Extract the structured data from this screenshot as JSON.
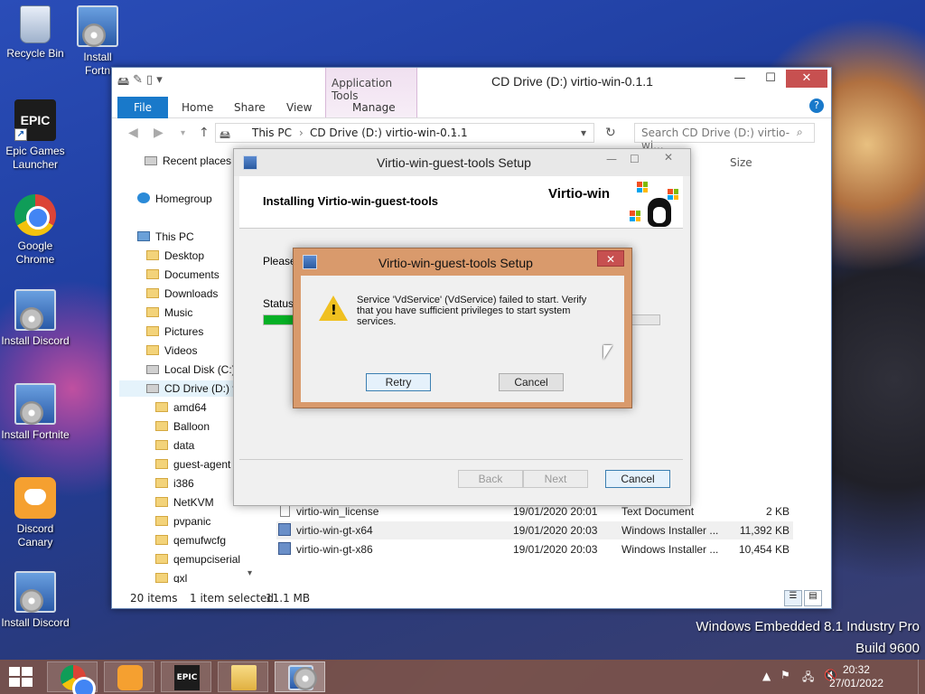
{
  "desktop": {
    "icons": [
      {
        "label": "Recycle Bin"
      },
      {
        "label": "Install Fortnite",
        "partial": "Install\nFortn"
      },
      {
        "label": "Epic Games Launcher"
      },
      {
        "label": "Google Chrome"
      },
      {
        "label": "Install Discord"
      },
      {
        "label": "Install Fortnite"
      },
      {
        "label": "Discord Canary"
      },
      {
        "label": "Install Discord"
      }
    ],
    "watermark": {
      "line1": "Windows Embedded 8.1 Industry Pro",
      "line2": "Build 9600"
    }
  },
  "explorer": {
    "title": "CD Drive (D:) virtio-win-0.1.1",
    "context_tab": "Application Tools",
    "ribbon": {
      "file": "File",
      "home": "Home",
      "share": "Share",
      "view": "View",
      "manage": "Manage"
    },
    "address": {
      "segments": [
        "This PC",
        "CD Drive (D:) virtio-win-0.1.1"
      ]
    },
    "search_placeholder": "Search CD Drive (D:) virtio-wi...",
    "nav": {
      "recent": "Recent places",
      "homegroup": "Homegroup",
      "thispc": "This PC",
      "desktop": "Desktop",
      "documents": "Documents",
      "downloads": "Downloads",
      "music": "Music",
      "pictures": "Pictures",
      "videos": "Videos",
      "localdisk": "Local Disk (C:)",
      "cddrive": "CD Drive (D:) v",
      "folders": [
        "amd64",
        "Balloon",
        "data",
        "guest-agent",
        "i386",
        "NetKVM",
        "pvpanic",
        "qemufwcfg",
        "qemupciserial",
        "qxl"
      ]
    },
    "column_size": "Size",
    "files": [
      {
        "name": "virtio-win_license",
        "date": "19/01/2020 20:01",
        "type": "Text Document",
        "size": "2 KB"
      },
      {
        "name": "virtio-win-gt-x64",
        "date": "19/01/2020 20:03",
        "type": "Windows Installer ...",
        "size": "11,392 KB"
      },
      {
        "name": "virtio-win-gt-x86",
        "date": "19/01/2020 20:03",
        "type": "Windows Installer ...",
        "size": "10,454 KB"
      }
    ],
    "status": {
      "count": "20 items",
      "selected": "1 item selected",
      "size": "11.1 MB"
    }
  },
  "setup": {
    "title": "Virtio-win-guest-tools Setup",
    "heading": "Installing Virtio-win-guest-tools",
    "brand": "Virtio-win",
    "please": "Please",
    "status_label": "Status:",
    "progress": 0.08,
    "buttons": {
      "back": "Back",
      "next": "Next",
      "cancel": "Cancel"
    }
  },
  "error": {
    "title": "Virtio-win-guest-tools Setup",
    "message": "Service 'VdService' (VdService) failed to start.  Verify that you have sufficient privileges to start system services.",
    "retry": "Retry",
    "cancel": "Cancel"
  },
  "taskbar": {
    "time": "20:32",
    "date": "27/01/2022"
  },
  "colors": {
    "accent": "#1979ca",
    "taskbar": "#785046",
    "error_frame": "#d99a6c"
  }
}
